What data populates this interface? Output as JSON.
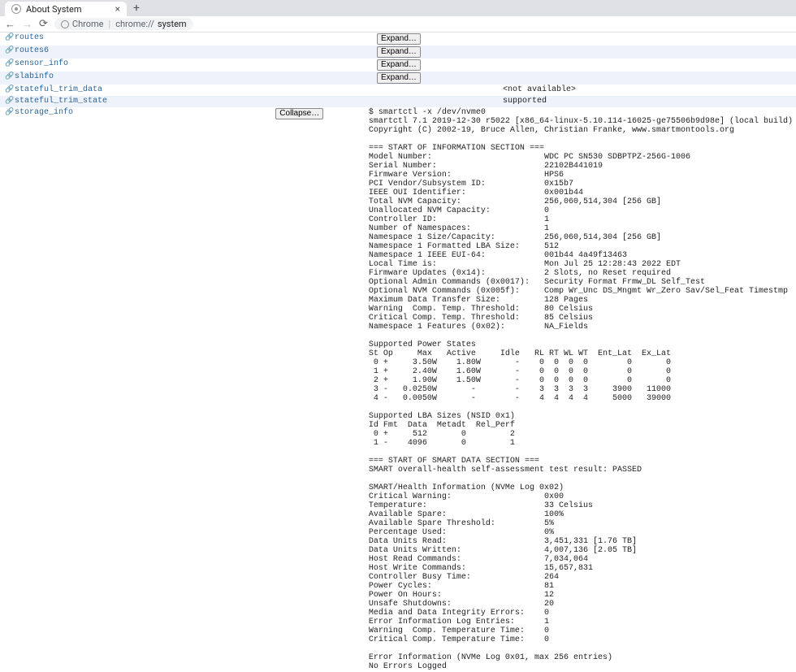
{
  "browser": {
    "tab_title": "About System",
    "url_host": "Chrome",
    "url_path_prefix": "chrome://",
    "url_path_page": "system"
  },
  "buttons": {
    "expand": "Expand…",
    "collapse": "Collapse…"
  },
  "rows": [
    {
      "name": "routes",
      "btn": "expand",
      "value": ""
    },
    {
      "name": "routes6",
      "btn": "expand",
      "value": ""
    },
    {
      "name": "sensor_info",
      "btn": "expand",
      "value": ""
    },
    {
      "name": "slabinfo",
      "btn": "expand",
      "value": ""
    },
    {
      "name": "stateful_trim_data",
      "btn": null,
      "value": "<not available>"
    },
    {
      "name": "stateful_trim_state",
      "btn": null,
      "value": "supported"
    },
    {
      "name": "storage_info",
      "btn": "collapse",
      "value": "$ smartctl -x /dev/nvme0\nsmartctl 7.1 2019-12-30 r5022 [x86_64-linux-5.10.114-16025-ge75506b9d98e] (local build)\nCopyright (C) 2002-19, Bruce Allen, Christian Franke, www.smartmontools.org\n\n=== START OF INFORMATION SECTION ===\nModel Number:                       WDC PC SN530 SDBPTPZ-256G-1006\nSerial Number:                      22102B441019\nFirmware Version:                   HPS6\nPCI Vendor/Subsystem ID:            0x15b7\nIEEE OUI Identifier:                0x001b44\nTotal NVM Capacity:                 256,060,514,304 [256 GB]\nUnallocated NVM Capacity:           0\nController ID:                      1\nNumber of Namespaces:               1\nNamespace 1 Size/Capacity:          256,060,514,304 [256 GB]\nNamespace 1 Formatted LBA Size:     512\nNamespace 1 IEEE EUI-64:            001b44 4a49f13463\nLocal Time is:                      Mon Jul 25 12:28:43 2022 EDT\nFirmware Updates (0x14):            2 Slots, no Reset required\nOptional Admin Commands (0x0017):   Security Format Frmw_DL Self_Test\nOptional NVM Commands (0x005f):     Comp Wr_Unc DS_Mngmt Wr_Zero Sav/Sel_Feat Timestmp\nMaximum Data Transfer Size:         128 Pages\nWarning  Comp. Temp. Threshold:     80 Celsius\nCritical Comp. Temp. Threshold:     85 Celsius\nNamespace 1 Features (0x02):        NA_Fields\n\nSupported Power States\nSt Op     Max   Active     Idle   RL RT WL WT  Ent_Lat  Ex_Lat\n 0 +     3.50W    1.80W       -    0  0  0  0        0       0\n 1 +     2.40W    1.60W       -    0  0  0  0        0       0\n 2 +     1.90W    1.50W       -    0  0  0  0        0       0\n 3 -   0.0250W       -        -    3  3  3  3     3900   11000\n 4 -   0.0050W       -        -    4  4  4  4     5000   39000\n\nSupported LBA Sizes (NSID 0x1)\nId Fmt  Data  Metadt  Rel_Perf\n 0 +     512       0         2\n 1 -    4096       0         1\n\n=== START OF SMART DATA SECTION ===\nSMART overall-health self-assessment test result: PASSED\n\nSMART/Health Information (NVMe Log 0x02)\nCritical Warning:                   0x00\nTemperature:                        33 Celsius\nAvailable Spare:                    100%\nAvailable Spare Threshold:          5%\nPercentage Used:                    0%\nData Units Read:                    3,451,331 [1.76 TB]\nData Units Written:                 4,007,136 [2.05 TB]\nHost Read Commands:                 7,034,064\nHost Write Commands:                15,657,831\nController Busy Time:               264\nPower Cycles:                       81\nPower On Hours:                     12\nUnsafe Shutdowns:                   20\nMedia and Data Integrity Errors:    0\nError Information Log Entries:      1\nWarning  Comp. Temperature Time:    0\nCritical Comp. Temperature Time:    0\n\nError Information (NVMe Log 0x01, max 256 entries)\nNo Errors Logged"
    }
  ]
}
